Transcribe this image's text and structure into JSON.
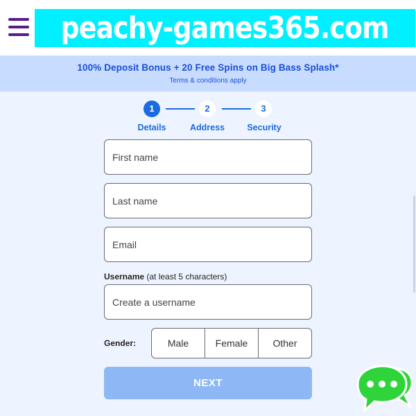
{
  "header": {
    "menu_icon": "hamburger-icon",
    "logo_text": "peachy-games365.com",
    "logo_bg": "#00f0ff",
    "menu_color": "#5a1a8c"
  },
  "promo": {
    "title": "100% Deposit Bonus + 20 Free Spins on Big Bass Splash*",
    "terms": "Terms & conditions apply"
  },
  "stepper": {
    "current_step": 1,
    "steps": [
      {
        "number": "1",
        "label": "Details"
      },
      {
        "number": "2",
        "label": "Address"
      },
      {
        "number": "3",
        "label": "Security"
      }
    ]
  },
  "form": {
    "first_name": {
      "placeholder": "First name",
      "value": ""
    },
    "last_name": {
      "placeholder": "Last name",
      "value": ""
    },
    "email": {
      "placeholder": "Email",
      "value": ""
    },
    "username": {
      "label": "Username",
      "hint": "(at least 5 characters)",
      "placeholder": "Create a username",
      "value": ""
    },
    "gender": {
      "label": "Gender:",
      "options": [
        "Male",
        "Female",
        "Other"
      ]
    },
    "next_label": "NEXT"
  },
  "chat": {
    "icon": "chat-bubbles-icon"
  },
  "colors": {
    "accent": "#1a6be0",
    "button_disabled": "#8db8f5",
    "page_bg": "#eef4ff",
    "promo_bg": "#c8dcff",
    "chat_green": "#2fd43a"
  }
}
